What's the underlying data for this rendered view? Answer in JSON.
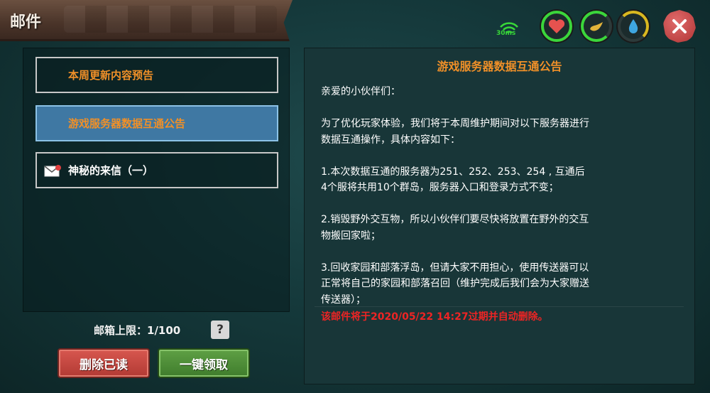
{
  "header": {
    "title": "邮件",
    "ping": "30ms"
  },
  "mail_list": [
    {
      "label": "本周更新内容预告",
      "selected": false,
      "color": "#f09028"
    },
    {
      "label": "游戏服务器数据互通公告",
      "selected": true,
      "color": "#f09028"
    },
    {
      "label": "神秘的来信（一）",
      "selected": false,
      "color": "#ffffff"
    }
  ],
  "footer": {
    "mailbox_limit": "邮箱上限：1/100",
    "help_label": "?",
    "delete_read_label": "删除已读",
    "claim_all_label": "一键领取"
  },
  "mail": {
    "title": "游戏服务器数据互通公告",
    "body": "亲爱的小伙伴们：\n\n为了优化玩家体验，我们将于本周维护期间对以下服务器进行\n数据互通操作，具体内容如下：\n\n1.本次数据互通的服务器为251、252、253、254 , 互通后\n4个服将共用10个群岛，服务器入口和登录方式不变；\n\n2.销毁野外交互物，所以小伙伴们要尽快将放置在野外的交互\n物搬回家啦；\n\n3.回收家园和部落浮岛，但请大家不用担心，使用传送器可以\n正常将自己的家园和部落召回（维护完成后我们会为大家赠送\n传送器）；",
    "expire_notice": "该邮件将于2020/05/22 14:27过期并自动删除。"
  },
  "colors": {
    "accent_orange": "#f09028",
    "warning_red": "#ee2424",
    "selected_blue": "#3f78a3"
  },
  "icons": [
    "signal-icon",
    "heart-icon",
    "food-icon",
    "water-drop-icon",
    "close-icon",
    "envelope-icon"
  ]
}
